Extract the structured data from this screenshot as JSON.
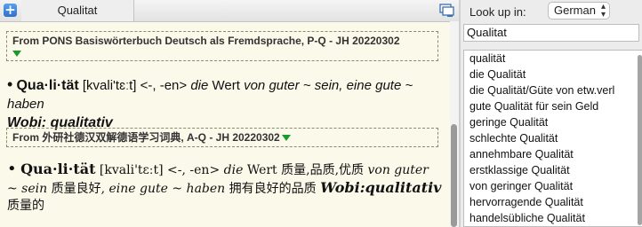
{
  "tab": {
    "label": "Qualitat"
  },
  "entries": [
    {
      "source": "From PONS Basiswörterbuch Deutsch als Fremdsprache, P-Q - JH 20220302",
      "headword": "Qua·li·tät",
      "pron": " [kvali'tɛːt] <-, -en> ",
      "def_it1": "die",
      "def_txt1": " Wert ",
      "def_it2": "von guter ~ sein, eine gute ~ haben",
      "wobi_label": "Wobi:",
      "wobi_val": " qualitativ"
    },
    {
      "source": "From 外研社德汉双解德语学习词典, A-Q - JH 20220302",
      "headword": "Qua·li·tät",
      "pron": " [kvali'tɛːt] <-, -en> ",
      "it1": "die",
      "t1": " Wert 质量,品质,优质 ",
      "it2": "von guter ~ sein",
      "t2": " 质量良好, ",
      "it3": "eine gute ~ haben",
      "t3": " 拥有良好的品质 ",
      "wobi": "Wobi:qualitativ",
      "t4": " 质量的"
    }
  ],
  "lookup": {
    "label": "Look up in:",
    "language": "German",
    "query": "Qualitat"
  },
  "results": [
    "qualität",
    "die Qualität",
    "die Qualität/Güte von etw.verl",
    "gute Qualität für sein Geld",
    "geringe Qualität",
    "schlechte Qualität",
    "annehmbare Qualität",
    "erstklassige Qualität",
    "von geringer Qualität",
    "hervorragende Qualität",
    "handelsübliche Qualität"
  ]
}
